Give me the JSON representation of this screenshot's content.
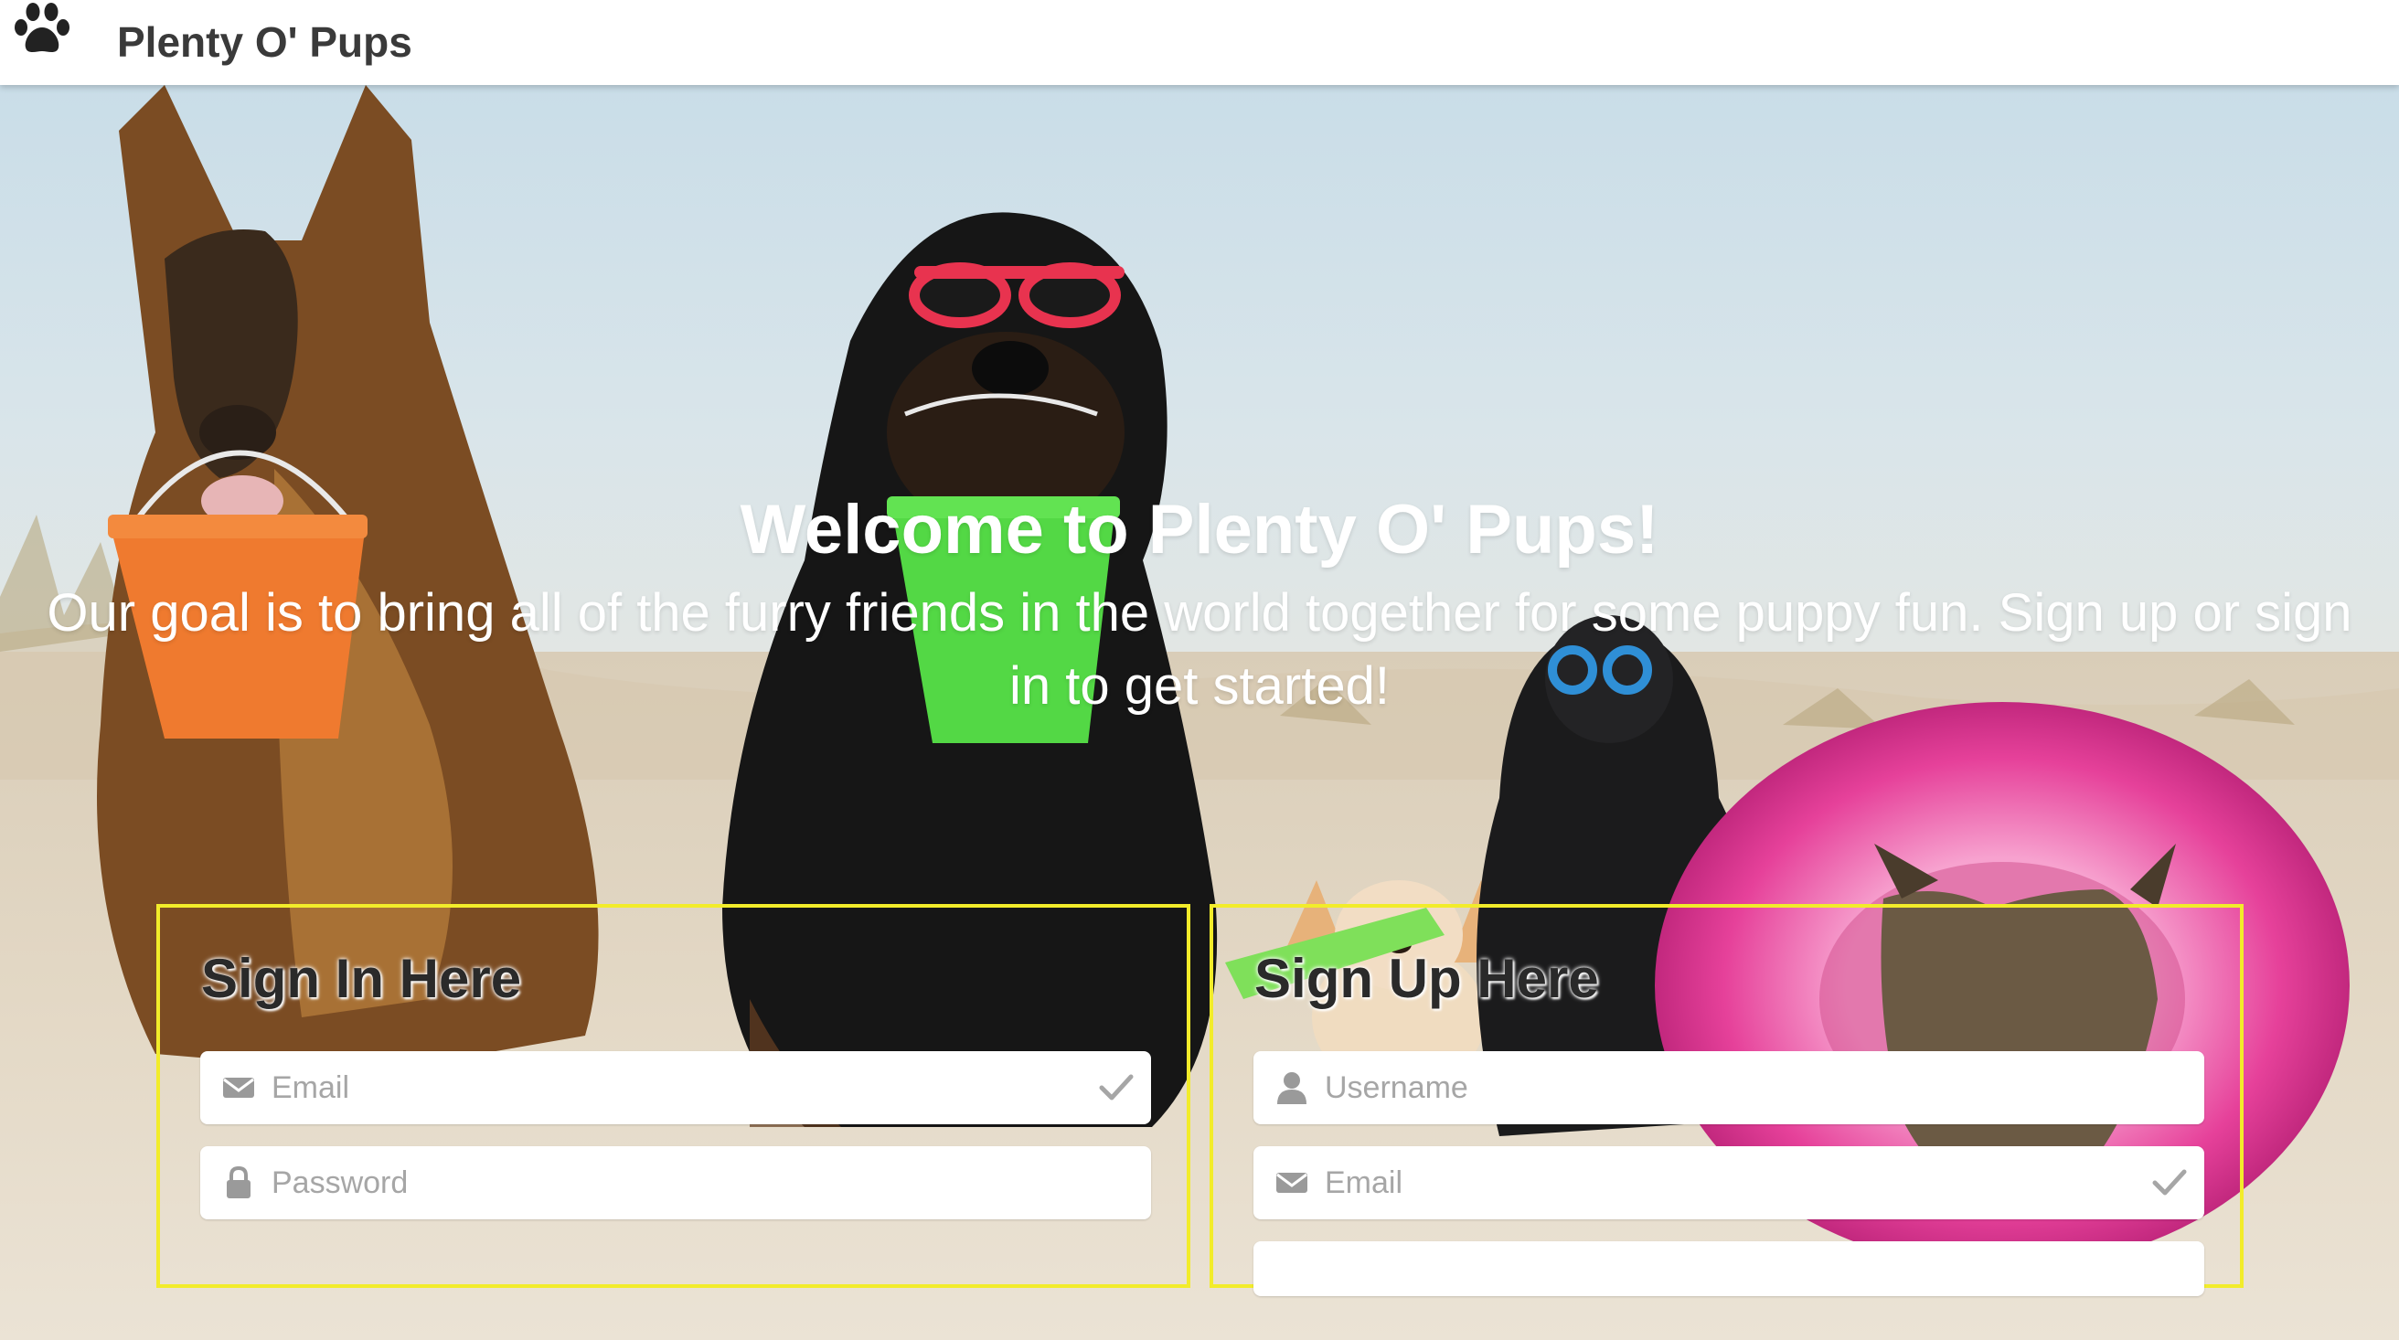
{
  "header": {
    "brand_icon": "paw-icon",
    "brand_name": "Plenty O' Pups"
  },
  "hero": {
    "title": "Welcome to Plenty O' Pups!",
    "subtitle": "Our goal is to bring all of the furry friends in the world together for some puppy fun. Sign up or sign in to get started!"
  },
  "signin": {
    "title": "Sign In Here",
    "email_placeholder": "Email",
    "password_placeholder": "Password"
  },
  "signup": {
    "title": "Sign Up Here",
    "username_placeholder": "Username",
    "email_placeholder": "Email"
  },
  "colors": {
    "panel_border": "#f2ec2a",
    "navbar_bg": "#ffffff",
    "brand_text": "#3a3a3a"
  }
}
